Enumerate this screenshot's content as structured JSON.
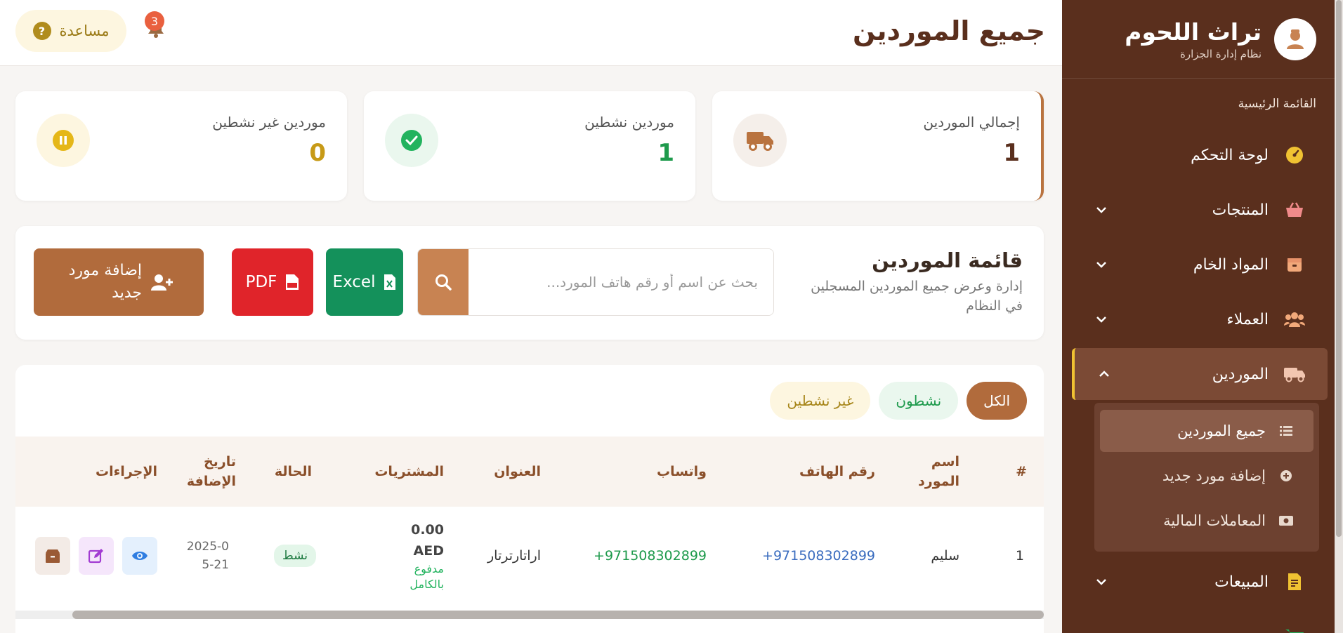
{
  "sidebar": {
    "brand_title": "تراث اللحوم",
    "brand_subtitle": "نظام إدارة الجزارة",
    "menu_heading": "القائمة الرئيسية",
    "items": [
      {
        "label": "لوحة التحكم",
        "icon": "dashboard-icon"
      },
      {
        "label": "المنتجات",
        "icon": "basket-icon"
      },
      {
        "label": "المواد الخام",
        "icon": "box-icon"
      },
      {
        "label": "العملاء",
        "icon": "users-icon"
      },
      {
        "label": "الموردين",
        "icon": "truck-icon"
      },
      {
        "label": "المبيعات",
        "icon": "invoice-icon"
      }
    ],
    "suppliers_submenu": [
      {
        "label": "جميع الموردين",
        "icon": "list-icon"
      },
      {
        "label": "إضافة مورد جديد",
        "icon": "plus-circle-icon"
      },
      {
        "label": "المعاملات المالية",
        "icon": "money-icon"
      }
    ]
  },
  "header": {
    "title": "جميع الموردين",
    "help_label": "مساعدة",
    "notifications_count": "3"
  },
  "stats": [
    {
      "label": "إجمالي الموردين",
      "value": "1",
      "color": "#5a2f1d"
    },
    {
      "label": "موردين نشطين",
      "value": "1",
      "color": "#1e9a4c"
    },
    {
      "label": "موردين غير نشطين",
      "value": "0",
      "color": "#c79a17"
    }
  ],
  "toolbar": {
    "title": "قائمة الموردين",
    "description": "إدارة وعرض جميع الموردين المسجلين في النظام",
    "search_placeholder": "بحث عن اسم أو رقم هاتف المورد...",
    "excel_label": "Excel",
    "pdf_label": "PDF",
    "add_label": "إضافة مورد جديد"
  },
  "filters": [
    "الكل",
    "نشطون",
    "غير نشطين"
  ],
  "table": {
    "columns": [
      "#",
      "اسم المورد",
      "رقم الهاتف",
      "واتساب",
      "العنوان",
      "المشتريات",
      "الحالة",
      "تاريخ الإضافة",
      "الإجراءات"
    ],
    "rows": [
      {
        "index": "1",
        "name": "سليم",
        "phone": "971508302899+",
        "whatsapp": "971508302899+",
        "address": "اراتارترتار",
        "purchases_amount": "0.00",
        "purchases_currency": "AED",
        "purchases_status": "مدفوع بالكامل",
        "status": "نشط",
        "date": "2025-05-21"
      }
    ]
  },
  "colors": {
    "sidebar_bg": "#5a2f1d",
    "accent": "#b16b3c",
    "active_indicator": "#f0c232"
  }
}
